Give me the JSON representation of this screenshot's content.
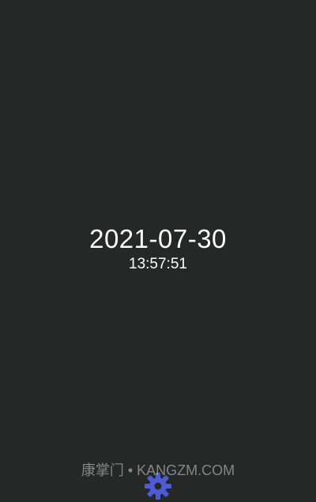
{
  "clock": {
    "date": "2021-07-30",
    "time": "13:57:51"
  },
  "watermark": {
    "text": "康掌门 • KANGZM.COM"
  },
  "settings": {
    "icon": "gear-icon",
    "color": "#4f5bd5"
  },
  "colors": {
    "background": "#262827",
    "text": "#ffffff"
  }
}
